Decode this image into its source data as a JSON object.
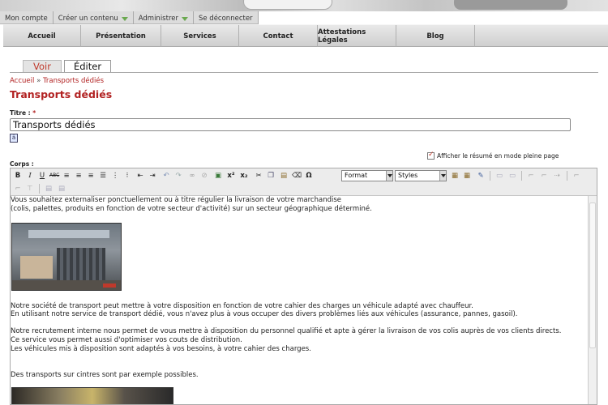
{
  "admin_bar": {
    "items": [
      {
        "label": "Mon compte",
        "dropdown": false
      },
      {
        "label": "Créer un contenu",
        "dropdown": true
      },
      {
        "label": "Administrer",
        "dropdown": true
      },
      {
        "label": "Se déconnecter",
        "dropdown": false
      }
    ]
  },
  "nav": {
    "items": [
      "Accueil",
      "Présentation",
      "Services",
      "Contact",
      "Attestations Légales",
      "Blog"
    ]
  },
  "tabs": {
    "view": "Voir",
    "edit": "Éditer"
  },
  "breadcrumb": {
    "home": "Accueil",
    "separator": "»",
    "current": "Transports dédiés"
  },
  "page_title": "Transports dédiés",
  "form": {
    "title_label": "Titre :",
    "title_required": "*",
    "title_value": "Transports dédiés",
    "summary_option": "Afficher le résumé en mode pleine page",
    "summary_checked": true,
    "body_label": "Corps :"
  },
  "editor": {
    "format_select": "Format",
    "styles_select": "Styles",
    "toolbar_icons": [
      "bold-icon",
      "italic-icon",
      "underline-icon",
      "strike-icon",
      "align-left-icon",
      "align-center-icon",
      "align-right-icon",
      "justify-icon",
      "numbered-list-icon",
      "bullet-list-icon",
      "outdent-icon",
      "indent-icon",
      "undo-icon",
      "redo-icon",
      "link-icon",
      "unlink-icon",
      "image-icon",
      "superscript-icon",
      "subscript-icon",
      "cut-icon",
      "copy-icon",
      "paste-icon",
      "remove-format-icon",
      "special-char-icon"
    ],
    "content": {
      "p1_line1": "Vous souhaitez externaliser ponctuellement ou à titre régulier la livraison de votre marchandise",
      "p1_line2": "(colis, palettes, produits en fonction de votre secteur d'activité) sur un secteur géographique déterminé.",
      "p2_line1": "Notre société de transport peut mettre à votre disposition en fonction de votre cahier des charges un véhicule adapté avec chauffeur.",
      "p2_line2": "En utilisant notre service de transport dédié, vous n'avez plus à vous occuper  des divers problèmes liés aux véhicules (assurance, pannes, gasoil).",
      "p3_line1": "Notre recrutement interne nous permet de vous mettre à disposition du personnel qualifié et apte à gérer la livraison de vos colis auprès de vos clients directs.",
      "p3_line2": "Ce service vous permet aussi d'optimiser vos couts de distribution.",
      "p3_line3": "Les véhicules mis à disposition sont adaptés à vos besoins, à votre cahier des charges.",
      "p4_line1": "Des transports sur cintres sont par exemple possibles."
    }
  }
}
